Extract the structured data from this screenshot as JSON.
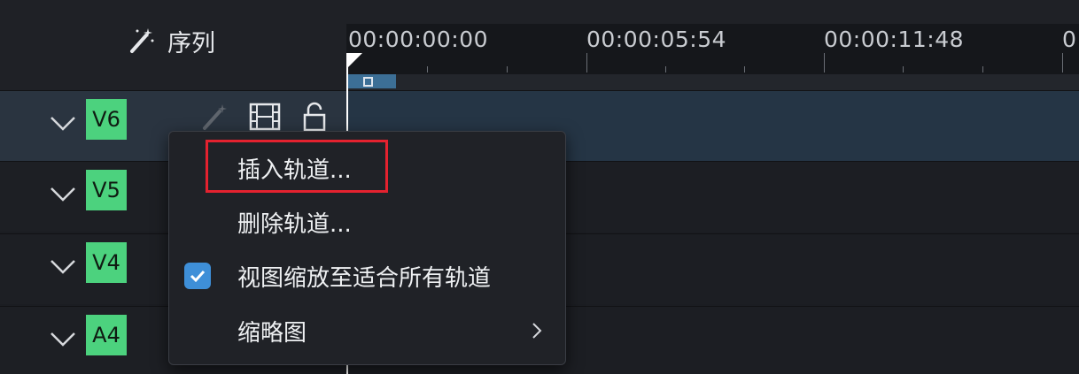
{
  "header": {
    "sequence_label": "序列"
  },
  "ruler": {
    "timecodes": [
      "00:00:00:00",
      "00:00:05:54",
      "00:00:11:48",
      "0"
    ]
  },
  "tracks": [
    {
      "tag": "V6",
      "active": true
    },
    {
      "tag": "V5"
    },
    {
      "tag": "V4"
    },
    {
      "tag": "A4"
    }
  ],
  "context_menu": {
    "items": [
      {
        "label": "插入轨道..."
      },
      {
        "label": "删除轨道..."
      },
      {
        "label": "视图缩放至适合所有轨道",
        "checked": true
      },
      {
        "label": "缩略图",
        "has_submenu": true
      }
    ]
  },
  "colors": {
    "track_tag": "#4cd27e",
    "active_track": "#2a3440",
    "checkbox": "#3e8fd8",
    "highlight_box": "#e4222f"
  }
}
